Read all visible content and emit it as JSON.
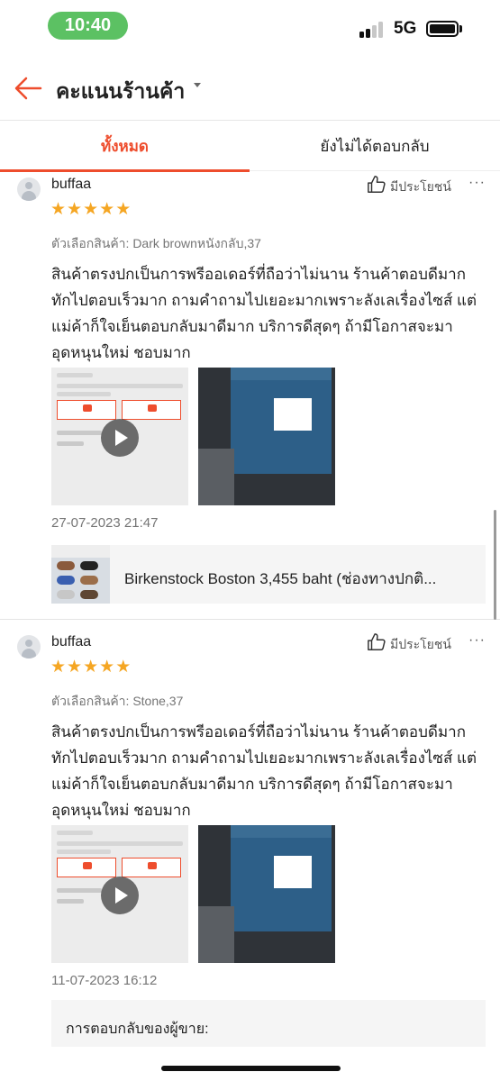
{
  "status_bar": {
    "time": "10:40",
    "network": "5G"
  },
  "header": {
    "title": "คะแนนร้านค้า"
  },
  "tabs": [
    {
      "label": "ทั้งหมด",
      "active": true
    },
    {
      "label": "ยังไม่ได้ตอบกลับ",
      "active": false
    }
  ],
  "reviews": [
    {
      "username": "buffaa",
      "rating": 5,
      "helpful_label": "มีประโยชน์",
      "more_label": "···",
      "variation": "ตัวเลือกสินค้า: Dark brownหนังกลับ,37",
      "text": "สินค้าตรงปกเป็นการพรีออเดอร์ที่ถือว่าไม่นาน ร้านค้าตอบดีมาก ทักไปตอบเร็วมาก ถามคำถามไปเยอะมากเพราะลังเลเรื่องไซส์ แต่แม่ค้าก็ใจเย็นตอบกลับมาดีมาก บริการดีสุดๆ ถ้ามีโอกาสจะมาอุดหนุนใหม่ ชอบมาก",
      "date": "27-07-2023 21:47",
      "product_name": "Birkenstock Boston 3,455 baht (ช่องทางปกติ..."
    },
    {
      "username": "buffaa",
      "rating": 5,
      "helpful_label": "มีประโยชน์",
      "more_label": "···",
      "variation": "ตัวเลือกสินค้า: Stone,37",
      "text": "สินค้าตรงปกเป็นการพรีออเดอร์ที่ถือว่าไม่นาน ร้านค้าตอบดีมาก ทักไปตอบเร็วมาก ถามคำถามไปเยอะมากเพราะลังเลเรื่องไซส์ แต่แม่ค้าก็ใจเย็นตอบกลับมาดีมาก บริการดีสุดๆ ถ้ามีโอกาสจะมาอุดหนุนใหม่ ชอบมาก",
      "date": "11-07-2023 16:12",
      "seller_reply_label": "การตอบกลับของผู้ขาย:"
    }
  ],
  "colors": {
    "accent": "#ee4d2d",
    "star": "#f5a623",
    "status_green": "#5cc163"
  }
}
